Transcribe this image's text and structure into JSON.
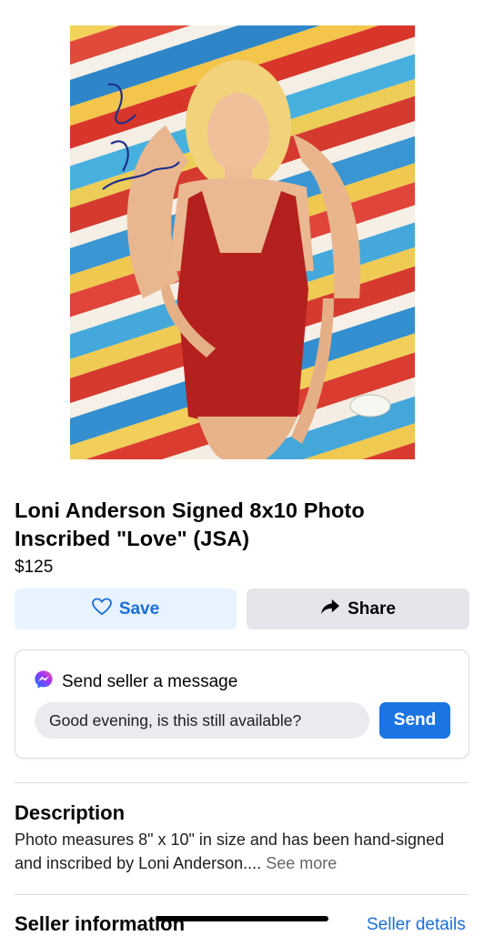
{
  "listing": {
    "title": "Loni Anderson Signed 8x10 Photo Inscribed \"Love\" (JSA)",
    "price": "$125",
    "photo_inscription": "Love Loni Anderson"
  },
  "actions": {
    "save_label": "Save",
    "share_label": "Share",
    "save_icon": "heart-outline-icon",
    "share_icon": "share-arrow-icon"
  },
  "message": {
    "heading": "Send seller a message",
    "icon": "messenger-icon",
    "input_value": "Good evening, is this still available?",
    "send_label": "Send"
  },
  "description": {
    "heading": "Description",
    "text": "Photo measures 8\" x 10\" in size and has been hand-signed and inscribed by Loni Anderson.... ",
    "see_more": "See more"
  },
  "seller": {
    "heading": "Seller information",
    "details_link": "Seller details"
  },
  "colors": {
    "accent": "#1b74e4",
    "save_bg": "#e7f3ff",
    "share_bg": "#e4e6eb",
    "swimsuit": "#b3201d"
  }
}
